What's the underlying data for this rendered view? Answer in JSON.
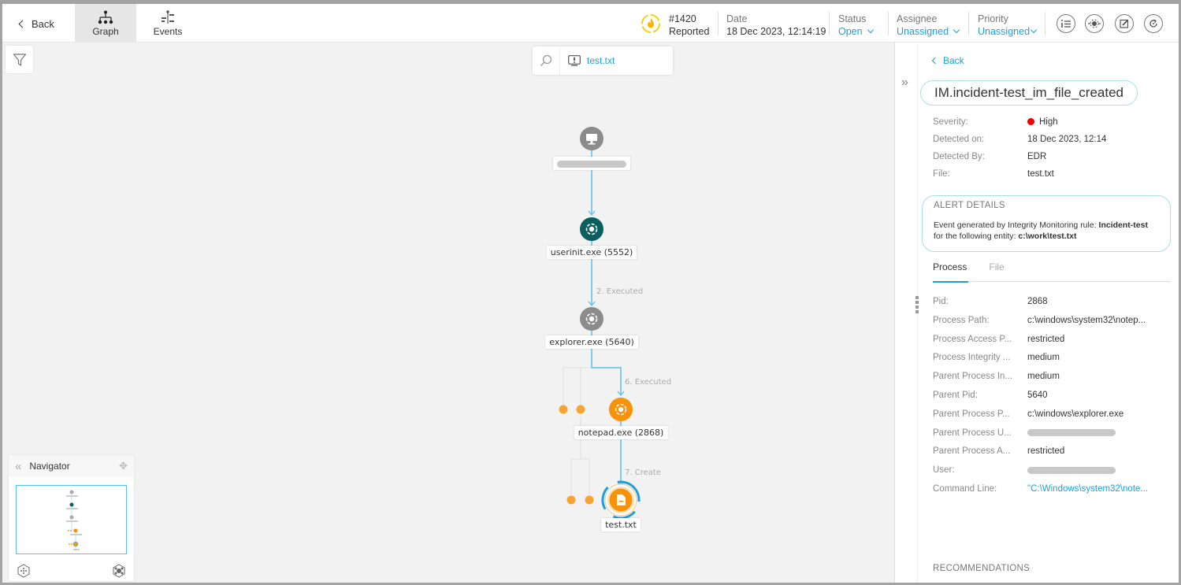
{
  "topbar": {
    "back_label": "Back",
    "tabs": [
      {
        "label": "Graph",
        "icon": "graph-tree-icon",
        "active": true
      },
      {
        "label": "Events",
        "icon": "events-timeline-icon",
        "active": false
      }
    ],
    "incident": {
      "id": "#1420",
      "state": "Reported",
      "icon": "incident-flame-icon"
    },
    "date": {
      "label": "Date",
      "value": "18 Dec 2023, 12:14:19"
    },
    "status": {
      "label": "Status",
      "value": "Open"
    },
    "assignee": {
      "label": "Assignee",
      "value": "Unassigned"
    },
    "priority": {
      "label": "Priority",
      "value": "Unassigned"
    },
    "actions": [
      "details-list-icon",
      "network-view-icon",
      "edit-icon",
      "refresh-icon"
    ]
  },
  "canvas": {
    "search": {
      "value": "test.txt"
    },
    "nodes": [
      {
        "id": "host",
        "label": "",
        "redacted": true,
        "type": "host",
        "color": "#8c8c8c"
      },
      {
        "id": "userinit",
        "label": "userinit.exe (5552)",
        "type": "process",
        "color": "#0b5e5e"
      },
      {
        "id": "explorer",
        "label": "explorer.exe (5640)",
        "type": "process",
        "color": "#8c8c8c"
      },
      {
        "id": "notepad",
        "label": "notepad.exe (2868)",
        "type": "process",
        "color": "#f7920a"
      },
      {
        "id": "testfile",
        "label": "test.txt",
        "type": "file",
        "color": "#f7920a"
      }
    ],
    "edges": [
      {
        "from": "host",
        "to": "userinit",
        "label": ""
      },
      {
        "from": "userinit",
        "to": "explorer",
        "label": "2. Executed"
      },
      {
        "from": "explorer",
        "to": "notepad",
        "label": "6. Executed"
      },
      {
        "from": "notepad",
        "to": "testfile",
        "label": "7. Create"
      }
    ],
    "accent_edge_color": "#5bc0f0",
    "cluster_dot_color": "#f7a532"
  },
  "navigator": {
    "title": "Navigator"
  },
  "panel": {
    "back_label": "Back",
    "title": "IM.incident-test_im_file_created",
    "summary": [
      {
        "key": "Severity:",
        "value": "High",
        "severity_color": "#e00000"
      },
      {
        "key": "Detected on:",
        "value": "18 Dec 2023, 12:14"
      },
      {
        "key": "Detected By:",
        "value": "EDR"
      },
      {
        "key": "File:",
        "value": "test.txt"
      }
    ],
    "alert": {
      "heading": "ALERT DETAILS",
      "text_prefix": "Event generated by Integrity Monitoring rule: ",
      "rule": "Incident-test",
      "text_middle": " for the following entity: ",
      "entity": "c:\\work\\test.txt"
    },
    "tabs": [
      {
        "label": "Process",
        "active": true
      },
      {
        "label": "File",
        "active": false
      }
    ],
    "process": [
      {
        "key": "Pid:",
        "value": "2868"
      },
      {
        "key": "Process Path:",
        "value": "c:\\windows\\system32\\notep..."
      },
      {
        "key": "Process Access P...",
        "value": "restricted"
      },
      {
        "key": "Process Integrity ...",
        "value": "medium"
      },
      {
        "key": "Parent Process In...",
        "value": "medium"
      },
      {
        "key": "Parent Pid:",
        "value": "5640"
      },
      {
        "key": "Parent Process P...",
        "value": "c:\\windows\\explorer.exe"
      },
      {
        "key": "Parent Process U...",
        "value": "",
        "redacted": true
      },
      {
        "key": "Parent Process A...",
        "value": "restricted"
      },
      {
        "key": "User:",
        "value": "",
        "redacted": true
      },
      {
        "key": "Command Line:",
        "value": "\"C:\\Windows\\system32\\note...",
        "link": true
      }
    ],
    "recommendations_heading": "RECOMMENDATIONS"
  }
}
